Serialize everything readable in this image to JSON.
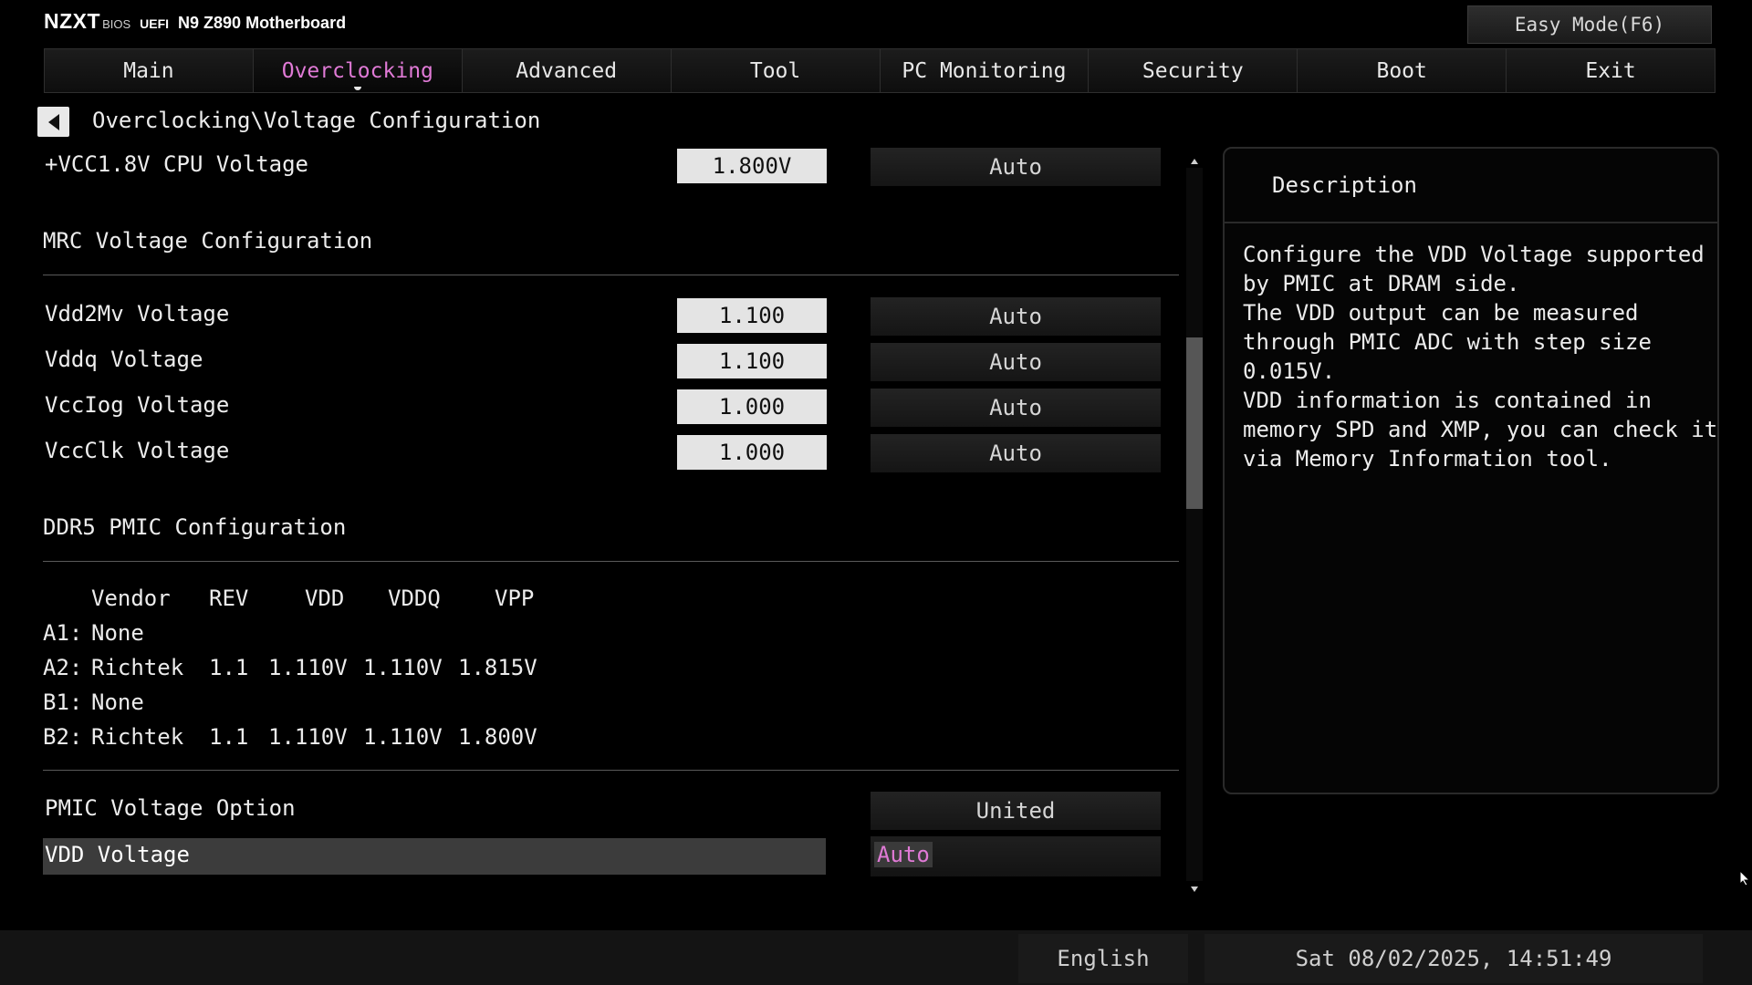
{
  "header": {
    "brand": "NZXT",
    "bios": "BIOS",
    "uefi": "UEFI",
    "model": "N9 Z890 Motherboard",
    "easy_mode": "Easy Mode(F6)"
  },
  "tabs": [
    {
      "label": "Main"
    },
    {
      "label": "Overclocking"
    },
    {
      "label": "Advanced"
    },
    {
      "label": "Tool"
    },
    {
      "label": "PC Monitoring"
    },
    {
      "label": "Security"
    },
    {
      "label": "Boot"
    },
    {
      "label": "Exit"
    }
  ],
  "active_tab": "Overclocking",
  "breadcrumb": "Overclocking\\Voltage Configuration",
  "vcc18": {
    "label": "+VCC1.8V CPU Voltage",
    "value": "1.800V",
    "option": "Auto"
  },
  "mrc": {
    "title": "MRC Voltage Configuration",
    "rows": [
      {
        "label": "Vdd2Mv Voltage",
        "value": "1.100",
        "option": "Auto"
      },
      {
        "label": "Vddq Voltage",
        "value": "1.100",
        "option": "Auto"
      },
      {
        "label": "VccIog Voltage",
        "value": "1.000",
        "option": "Auto"
      },
      {
        "label": "VccClk Voltage",
        "value": "1.000",
        "option": "Auto"
      }
    ]
  },
  "pmic": {
    "title": "DDR5 PMIC Configuration",
    "headers": {
      "vendor": "Vendor",
      "rev": "REV",
      "vdd": "VDD",
      "vddq": "VDDQ",
      "vpp": "VPP"
    },
    "rows": [
      {
        "slot": "A1:",
        "vendor": "None",
        "rev": "",
        "vdd": "",
        "vddq": "",
        "vpp": ""
      },
      {
        "slot": "A2:",
        "vendor": "Richtek",
        "rev": "1.1",
        "vdd": "1.110V",
        "vddq": "1.110V",
        "vpp": "1.815V"
      },
      {
        "slot": "B1:",
        "vendor": "None",
        "rev": "",
        "vdd": "",
        "vddq": "",
        "vpp": ""
      },
      {
        "slot": "B2:",
        "vendor": "Richtek",
        "rev": "1.1",
        "vdd": "1.110V",
        "vddq": "1.110V",
        "vpp": "1.800V"
      }
    ]
  },
  "pmic_option": {
    "label": "PMIC Voltage Option",
    "value": "United"
  },
  "vdd_voltage": {
    "label": "VDD  Voltage",
    "value": "Auto"
  },
  "description": {
    "title": "Description",
    "lines": [
      "Configure the VDD Voltage supported",
      "by PMIC at DRAM side.",
      "The VDD output can be measured",
      "through PMIC ADC with step size",
      "0.015V.",
      "VDD information is contained in",
      "memory SPD and XMP, you can check it",
      "via Memory Information tool."
    ]
  },
  "footer": {
    "language": "English",
    "datetime": "Sat 08/02/2025, 14:51:49"
  },
  "colors": {
    "accent": "#e07ad6",
    "background": "#000000",
    "value_box": "#e4e4e4"
  }
}
